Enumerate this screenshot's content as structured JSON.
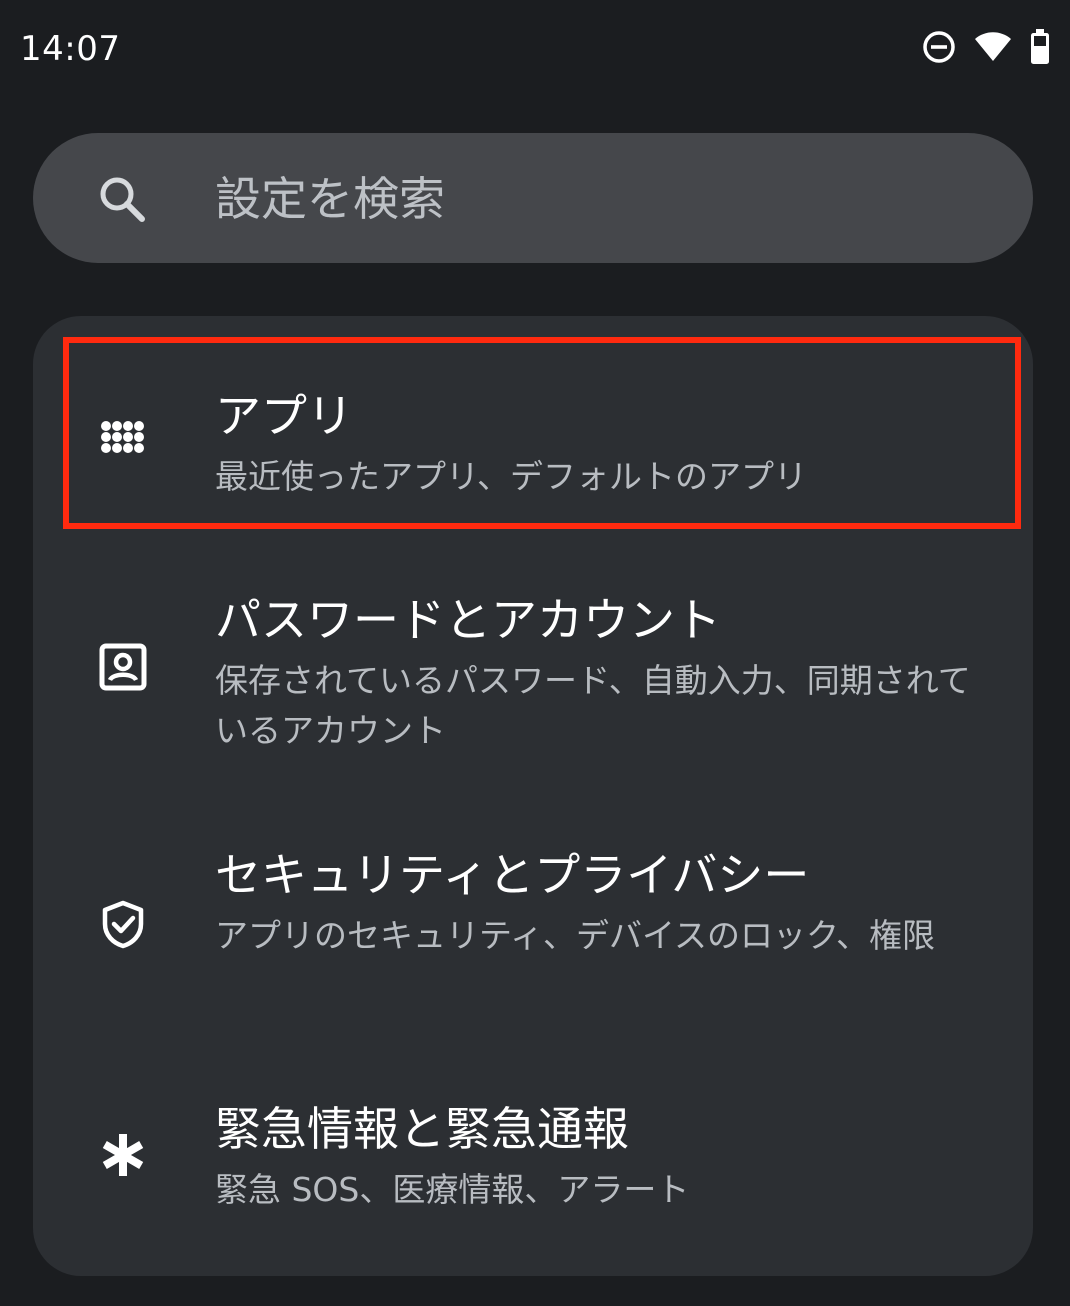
{
  "status_bar": {
    "time": "14:07",
    "icons": [
      "do-not-disturb-icon",
      "wifi-icon",
      "battery-icon"
    ]
  },
  "search": {
    "placeholder": "設定を検索",
    "icon": "search-icon"
  },
  "settings": {
    "items": [
      {
        "title": "アプリ",
        "summary": "最近使ったアプリ、デフォルトのアプリ",
        "icon": "apps-grid-icon",
        "highlighted": true
      },
      {
        "title": "パスワードとアカウント",
        "summary": "保存されているパスワード、自動入力、同期されているアカウント",
        "icon": "account-box-icon"
      },
      {
        "title": "セキュリティとプライバシー",
        "summary": "アプリのセキュリティ、デバイスのロック、権限",
        "icon": "shield-check-icon"
      },
      {
        "title": "緊急情報と緊急通報",
        "summary": "緊急 SOS、医療情報、アラート",
        "icon": "asterisk-icon"
      }
    ]
  },
  "colors": {
    "background": "#1b1d20",
    "card": "#2c2f33",
    "search_bar": "#45474b",
    "highlight": "#ff2a0f"
  }
}
